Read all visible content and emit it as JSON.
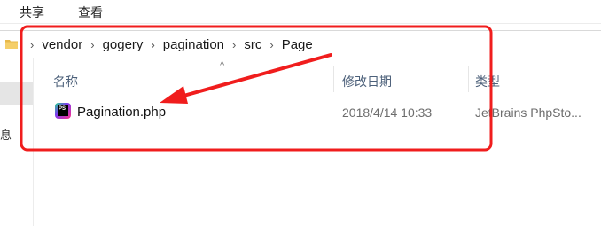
{
  "ribbon": {
    "tabs": [
      "共享",
      "查看"
    ]
  },
  "address_bar": {
    "folder_icon": "folder-icon",
    "crumbs": [
      "vendor",
      "gogery",
      "pagination",
      "src",
      "Page"
    ],
    "separator": "›"
  },
  "nav": {
    "glyph": "息"
  },
  "columns": {
    "sort_indicator": "^",
    "name": "名称",
    "date": "修改日期",
    "type": "类型"
  },
  "files": [
    {
      "icon": "phpstorm-icon",
      "icon_text": "PS",
      "name": "Pagination.php",
      "modified": "2018/4/14 10:33",
      "type": "JetBrains PhpSto..."
    }
  ],
  "annotation": {
    "highlight_color": "#f01d1d"
  }
}
